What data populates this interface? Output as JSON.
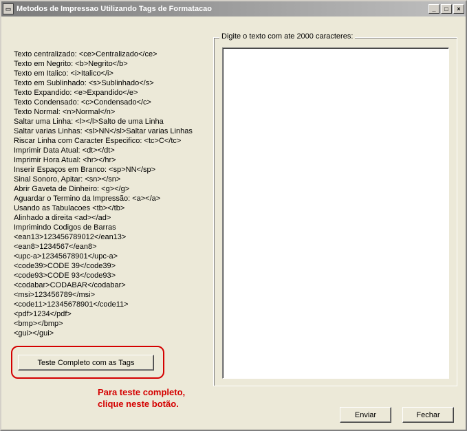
{
  "window": {
    "title": "Metodos de Impressao Utilizando Tags de Formatacao"
  },
  "groupbox": {
    "label": "Digite o texto com ate 2000 caracteres:"
  },
  "textarea": {
    "value": "",
    "placeholder": ""
  },
  "buttons": {
    "test": "Teste Completo com as Tags",
    "enviar": "Enviar",
    "fechar": "Fechar"
  },
  "annotation": {
    "line1": "Para teste completo,",
    "line2": "clique neste botão."
  },
  "help_lines": [
    "Texto centralizado: <ce>Centralizado</ce>",
    "Texto em Negrito: <b>Negrito</b>",
    "Texto em Italico: <i>Italico</i>",
    "Texto em Sublinhado: <s>Sublinhado</s>",
    "Texto Expandido: <e>Expandido</e>",
    "Texto Condensado: <c>Condensado</c>",
    "Texto Normal: <n>Normal</n>",
    "Saltar uma Linha: <l></l>Salto de uma Linha",
    "Saltar varias Linhas: <sl>NN</sl>Saltar varias Linhas",
    "Riscar Linha com Caracter Especifico: <tc>C</tc>",
    "Imprimir Data Atual: <dt></dt>",
    "Imprimir Hora Atual: <hr></hr>",
    "Inserir Espaços em Branco: <sp>NN</sp>",
    "Sinal Sonoro, Apitar: <sn></sn>",
    "Abrir Gaveta de Dinheiro: <g></g>",
    "Aguardar o Termino da Impressão: <a></a>",
    "Usando as Tabulacoes <tb></tb>",
    "Alinhado a direita <ad></ad>",
    "Imprimindo Codigos de Barras",
    "<ean13>123456789012</ean13>",
    "<ean8>1234567</ean8>",
    "<upc-a>12345678901</upc-a>",
    "<code39>CODE 39</code39>",
    "<code93>CODE 93</code93>",
    "<codabar>CODABAR</codabar>",
    "<msi>123456789</msi>",
    "<code11>12345678901</code11>",
    "<pdf>1234</pdf>",
    "<bmp></bmp>",
    "<gui></gui>"
  ]
}
